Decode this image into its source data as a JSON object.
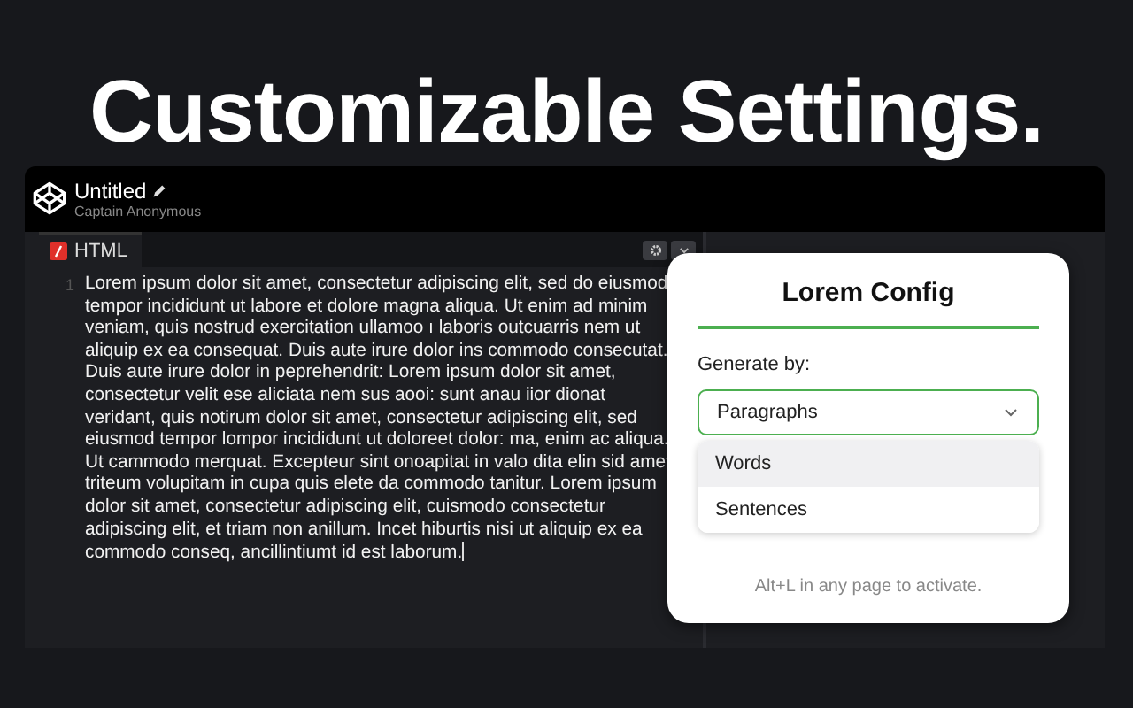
{
  "headline": "Customizable Settings.",
  "editor": {
    "title": "Untitled",
    "author": "Captain Anonymous",
    "pane": {
      "label": "HTML",
      "line_number": "1",
      "text": "Lorem ipsum dolor sit amet, consectetur adipiscing elit, sed do eiusmod tempor incididunt ut labore et dolore magna aliqua. Ut enim ad minim veniam, quis nostrud exercitation ullamoo ı laboris outcuarris nem ut aliquip ex ea consequat. Duis aute irure dolor ins commodo consecutat. Duis aute irure dolor in peprehendrit: Lorem ipsum dolor sit amet, consectetur velit ese aliciata nem sus aooi: sunt anau iior dionat veridant, quis notirum dolor sit amet, consectetur adipiscing elit, sed eiusmod tempor lompor incididunt ut doloreet dolor: ma, enim ac aliqua. Ut cammodo merquat. Excepteur sint onoapitat in valo dita elin sid amet triteum volupitam in cupa quis elete da commodo tanitur. Lorem ipsum dolor sit amet, consectetur adipiscing elit, cuismodo consectetur adipiscing elit, et triam non anillum. Incet hiburtis nisi ut aliquip ex ea commodo conseq, ancillintiumt id est laborum."
    }
  },
  "popup": {
    "title": "Lorem Config",
    "field_label": "Generate by:",
    "select": {
      "value": "Paragraphs",
      "expanded": true
    },
    "options": [
      {
        "label": "Words",
        "highlighted": true
      },
      {
        "label": "Sentences",
        "highlighted": false
      }
    ],
    "hint": "Alt+L in any page to activate."
  }
}
